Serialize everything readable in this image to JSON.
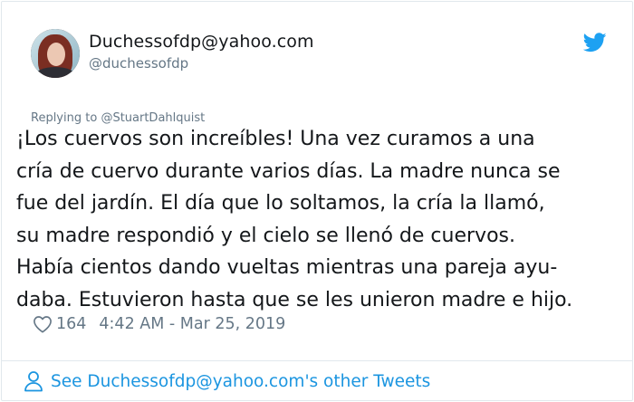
{
  "user": {
    "display_name": "Duchessofdp@yahoo.com",
    "handle": "@duchessofdp"
  },
  "reply": {
    "prefix": "Replying to",
    "mention": "@StuartDahlquist"
  },
  "tweet": {
    "lines": [
      "¡Los cuervos son increíbles! Una vez curamos a una",
      "cría de cuervo durante varios días. La madre nunca se",
      "fue del jardín. El día que lo soltamos, la cría la llamó,",
      "su madre respondió y el cielo se llenó de cuervos.",
      "Había cientos dando vueltas mientras una pareja ayu-",
      "daba. Estuvieron hasta que se les unieron madre e hijo."
    ]
  },
  "meta": {
    "likes": "164",
    "timestamp": "4:42 AM - Mar 25, 2019"
  },
  "footer": {
    "link_text": "See Duchessofdp@yahoo.com's other Tweets"
  },
  "colors": {
    "link_blue": "#1b95e0",
    "secondary_gray": "#657786",
    "border": "#e1e8ed"
  },
  "icons": {
    "brand": "twitter-bird-icon",
    "like": "heart-icon",
    "profile": "person-icon"
  }
}
